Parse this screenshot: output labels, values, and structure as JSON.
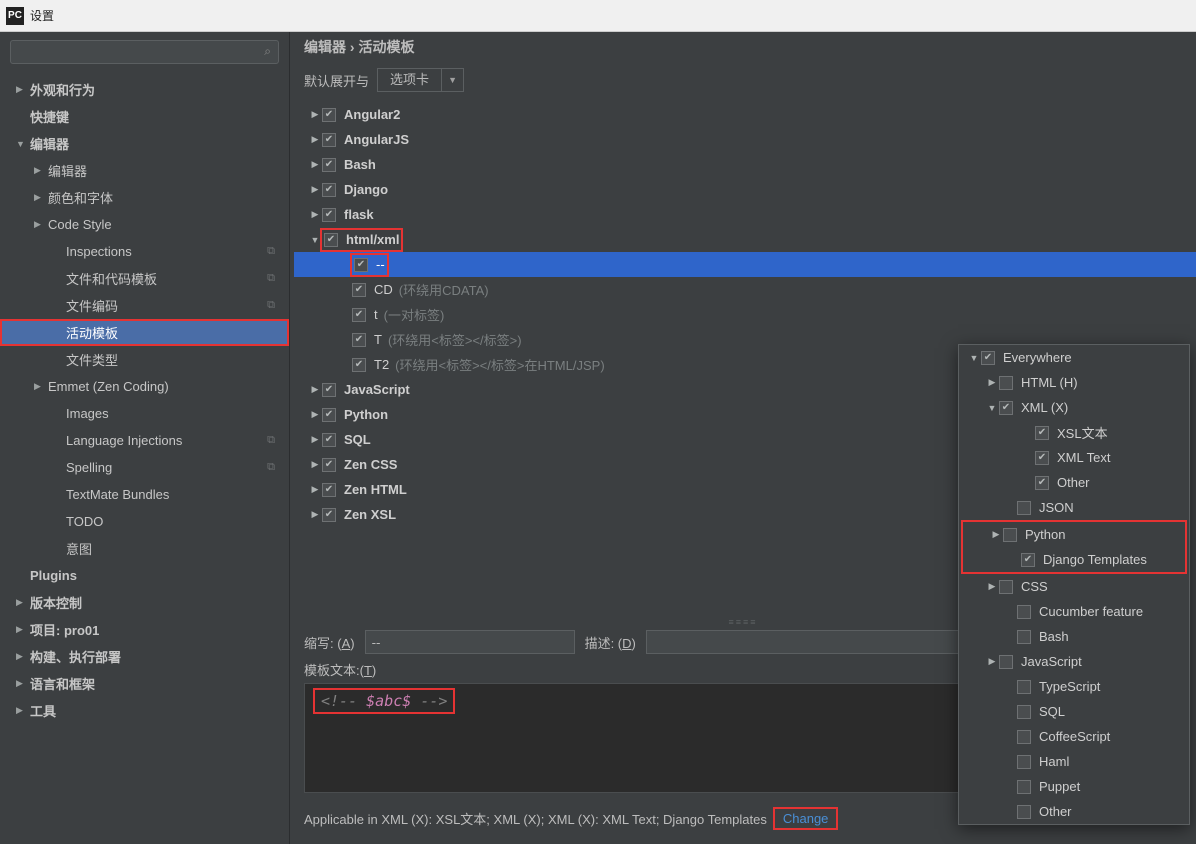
{
  "titlebar": {
    "logo": "PC",
    "title": "设置"
  },
  "search": {
    "placeholder": ""
  },
  "sidebar": [
    {
      "label": "外观和行为",
      "depth": 0,
      "arrow": "▶",
      "bold": true
    },
    {
      "label": "快捷键",
      "depth": 0,
      "arrow": "",
      "bold": true
    },
    {
      "label": "编辑器",
      "depth": 0,
      "arrow": "▼",
      "bold": true
    },
    {
      "label": "编辑器",
      "depth": 1,
      "arrow": "▶"
    },
    {
      "label": "颜色和字体",
      "depth": 1,
      "arrow": "▶"
    },
    {
      "label": "Code Style",
      "depth": 1,
      "arrow": "▶"
    },
    {
      "label": "Inspections",
      "depth": 2,
      "arrow": "",
      "after": "⧉"
    },
    {
      "label": "文件和代码模板",
      "depth": 2,
      "arrow": "",
      "after": "⧉"
    },
    {
      "label": "文件编码",
      "depth": 2,
      "arrow": "",
      "after": "⧉"
    },
    {
      "label": "活动模板",
      "depth": 2,
      "arrow": "",
      "selected": true,
      "redbox": true
    },
    {
      "label": "文件类型",
      "depth": 2,
      "arrow": ""
    },
    {
      "label": "Emmet (Zen Coding)",
      "depth": 1,
      "arrow": "▶"
    },
    {
      "label": "Images",
      "depth": 2,
      "arrow": ""
    },
    {
      "label": "Language Injections",
      "depth": 2,
      "arrow": "",
      "after": "⧉"
    },
    {
      "label": "Spelling",
      "depth": 2,
      "arrow": "",
      "after": "⧉"
    },
    {
      "label": "TextMate Bundles",
      "depth": 2,
      "arrow": ""
    },
    {
      "label": "TODO",
      "depth": 2,
      "arrow": ""
    },
    {
      "label": "意图",
      "depth": 2,
      "arrow": ""
    },
    {
      "label": "Plugins",
      "depth": 0,
      "arrow": "",
      "bold": true
    },
    {
      "label": "版本控制",
      "depth": 0,
      "arrow": "▶",
      "bold": true
    },
    {
      "label": "项目: pro01",
      "depth": 0,
      "arrow": "▶",
      "bold": true
    },
    {
      "label": "构建、执行部署",
      "depth": 0,
      "arrow": "▶",
      "bold": true
    },
    {
      "label": "语言和框架",
      "depth": 0,
      "arrow": "▶",
      "bold": true
    },
    {
      "label": "工具",
      "depth": 0,
      "arrow": "▶",
      "bold": true
    }
  ],
  "breadcrumb": "编辑器 › 活动模板",
  "expand": {
    "label": "默认展开与",
    "value": "选项卡"
  },
  "templates": [
    {
      "type": "group",
      "arrow": "▶",
      "checked": true,
      "name": "Angular2"
    },
    {
      "type": "group",
      "arrow": "▶",
      "checked": true,
      "name": "AngularJS"
    },
    {
      "type": "group",
      "arrow": "▶",
      "checked": true,
      "name": "Bash"
    },
    {
      "type": "group",
      "arrow": "▶",
      "checked": true,
      "name": "Django"
    },
    {
      "type": "group",
      "arrow": "▶",
      "checked": true,
      "name": "flask"
    },
    {
      "type": "group",
      "arrow": "▼",
      "checked": true,
      "name": "html/xml",
      "redbox": true
    },
    {
      "type": "item",
      "checked": true,
      "name": "--",
      "hint": "",
      "selected": true,
      "redbox": true
    },
    {
      "type": "item",
      "checked": true,
      "name": "CD",
      "hint": "(环绕用CDATA)"
    },
    {
      "type": "item",
      "checked": true,
      "name": "t",
      "hint": "(一对标签)"
    },
    {
      "type": "item",
      "checked": true,
      "name": "T",
      "hint": "(环绕用<标签></标签>)"
    },
    {
      "type": "item",
      "checked": true,
      "name": "T2",
      "hint": "(环绕用<标签></标签>在HTML/JSP)"
    },
    {
      "type": "group",
      "arrow": "▶",
      "checked": true,
      "name": "JavaScript"
    },
    {
      "type": "group",
      "arrow": "▶",
      "checked": true,
      "name": "Python"
    },
    {
      "type": "group",
      "arrow": "▶",
      "checked": true,
      "name": "SQL"
    },
    {
      "type": "group",
      "arrow": "▶",
      "checked": true,
      "name": "Zen CSS"
    },
    {
      "type": "group",
      "arrow": "▶",
      "checked": true,
      "name": "Zen HTML"
    },
    {
      "type": "group",
      "arrow": "▶",
      "checked": true,
      "name": "Zen XSL"
    }
  ],
  "abbr": {
    "label_pre": "缩写: (",
    "label_u": "A",
    "label_post": ")",
    "value": "--"
  },
  "desc": {
    "label_pre": "描述: (",
    "label_u": "D",
    "label_post": ")",
    "value": ""
  },
  "tmpltxt": {
    "label_pre": "模板文本:(",
    "label_u": "T",
    "label_post": ")"
  },
  "code": {
    "open": "<!-- ",
    "var": "$abc$",
    "close": " -->"
  },
  "applicable": "Applicable in XML (X): XSL文本; XML (X); XML (X): XML Text; Django Templates",
  "change": "Change",
  "context": [
    {
      "depth": 0,
      "arrow": "▼",
      "checked": true,
      "label": "Everywhere"
    },
    {
      "depth": 1,
      "arrow": "▶",
      "checked": false,
      "label": "HTML (H)"
    },
    {
      "depth": 1,
      "arrow": "▼",
      "checked": true,
      "label": "XML (X)"
    },
    {
      "depth": 3,
      "arrow": "",
      "checked": true,
      "label": "XSL文本"
    },
    {
      "depth": 3,
      "arrow": "",
      "checked": true,
      "label": "XML Text"
    },
    {
      "depth": 3,
      "arrow": "",
      "checked": true,
      "label": "Other"
    },
    {
      "depth": 2,
      "arrow": "",
      "checked": false,
      "label": "JSON"
    },
    {
      "depth": 1,
      "arrow": "▶",
      "checked": false,
      "label": "Python",
      "redsec": "start"
    },
    {
      "depth": 2,
      "arrow": "",
      "checked": true,
      "label": "Django Templates",
      "redsec": "end"
    },
    {
      "depth": 1,
      "arrow": "▶",
      "checked": false,
      "label": "CSS"
    },
    {
      "depth": 2,
      "arrow": "",
      "checked": false,
      "label": "Cucumber feature"
    },
    {
      "depth": 2,
      "arrow": "",
      "checked": false,
      "label": "Bash"
    },
    {
      "depth": 1,
      "arrow": "▶",
      "checked": false,
      "label": "JavaScript"
    },
    {
      "depth": 2,
      "arrow": "",
      "checked": false,
      "label": "TypeScript"
    },
    {
      "depth": 2,
      "arrow": "",
      "checked": false,
      "label": "SQL"
    },
    {
      "depth": 2,
      "arrow": "",
      "checked": false,
      "label": "CoffeeScript"
    },
    {
      "depth": 2,
      "arrow": "",
      "checked": false,
      "label": "Haml"
    },
    {
      "depth": 2,
      "arrow": "",
      "checked": false,
      "label": "Puppet"
    },
    {
      "depth": 2,
      "arrow": "",
      "checked": false,
      "label": "Other"
    }
  ]
}
